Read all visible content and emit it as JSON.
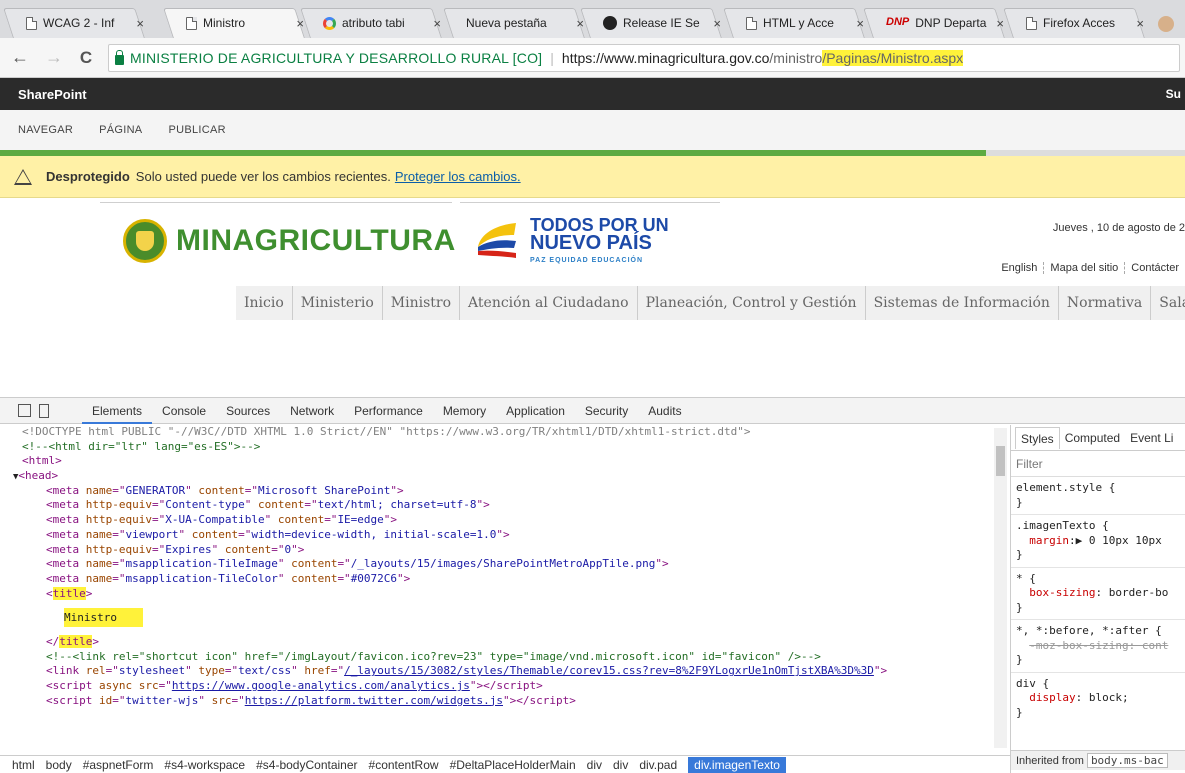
{
  "browser": {
    "tabs": [
      {
        "title": "WCAG 2 - Inf",
        "icon": "page-icon"
      },
      {
        "title": "Ministro",
        "icon": "page-icon",
        "active": true
      },
      {
        "title": "atributo tabi",
        "icon": "google-icon"
      },
      {
        "title": "Nueva pestaña",
        "icon": "none"
      },
      {
        "title": "Release IE Se",
        "icon": "github-icon"
      },
      {
        "title": "HTML y Acce",
        "icon": "page-icon"
      },
      {
        "title": "DNP Departa",
        "icon": "dnp-icon"
      },
      {
        "title": "Firefox Acces",
        "icon": "page-icon"
      }
    ],
    "close_glyph": "×",
    "dnp_logo": "DNP",
    "back": "←",
    "forward": "→",
    "reload": "C",
    "secure_label": "MINISTERIO DE AGRICULTURA Y DESARROLLO RURAL [CO]",
    "url_host": "https://www.minagricultura.gov.co",
    "url_path": "/ministro",
    "url_path_highlighted": "/Paginas/Ministro.aspx"
  },
  "sharepoint": {
    "brand": "SharePoint",
    "right_text": "Su",
    "ribbon": [
      "NAVEGAR",
      "PÁGINA",
      "PUBLICAR"
    ],
    "progress": 0.832,
    "status_bold": "Desprotegido",
    "status_text": "Solo usted puede ver los cambios recientes.",
    "status_link": "Proteger los cambios."
  },
  "site": {
    "logo_text": "MINAGRICULTURA",
    "logo2_l1": "TODOS POR UN",
    "logo2_l2": "NUEVO PAÍS",
    "logo2_l3": "PAZ  EQUIDAD  EDUCACIÓN",
    "date": "Jueves , 10 de agosto de 2",
    "top_links": [
      "English",
      "Mapa del sitio",
      "Contácter"
    ],
    "nav": [
      "Inicio",
      "Ministerio",
      "Ministro",
      "Atención al Ciudadano",
      "Planeación, Control y Gestión",
      "Sistemas de Información",
      "Normativa",
      "Sala de P"
    ]
  },
  "devtools": {
    "tabs": [
      "Elements",
      "Console",
      "Sources",
      "Network",
      "Performance",
      "Memory",
      "Application",
      "Security",
      "Audits"
    ],
    "breadcrumbs": [
      "html",
      "body",
      "#aspnetForm",
      "#s4-workspace",
      "#s4-bodyContainer",
      "#contentRow",
      "#DeltaPlaceHolderMain",
      "div",
      "div",
      "div.pad",
      "div.imagenTexto"
    ],
    "styles_tabs": [
      "Styles",
      "Computed",
      "Event Li"
    ],
    "filter_placeholder": "Filter",
    "inherited_label": "Inherited from",
    "inherited_selector": "body.ms-bac",
    "code": {
      "l1": "<!DOCTYPE html PUBLIC \"-//W3C//DTD XHTML 1.0 Strict//EN\" \"https://www.w3.org/TR/xhtml1/DTD/xhtml1-strict.dtd\">",
      "l2": "<!--<html dir=\"ltr\" lang=\"es-ES\">-->",
      "l3": "<html>",
      "l4": "<head>",
      "m1_name": "GENERATOR",
      "m1_content": "Microsoft SharePoint",
      "m2_equiv": "Content-type",
      "m2_content": "text/html; charset=utf-8",
      "m3_equiv": "X-UA-Compatible",
      "m3_content": "IE=edge",
      "m4_name": "viewport",
      "m4_content": "width=device-width, initial-scale=1.0",
      "m5_equiv": "Expires",
      "m5_content": "0",
      "m6_name": "msapplication-TileImage",
      "m6_content": "/_layouts/15/images/SharePointMetroAppTile.png",
      "m7_name": "msapplication-TileColor",
      "m7_content": "#0072C6",
      "title_tag": "title",
      "title_text": "Ministro",
      "c2": "<!--<link rel=\"shortcut icon\" href=\"/imgLayout/favicon.ico?rev=23\" type=\"image/vnd.microsoft.icon\" id=\"favicon\" />-->",
      "link_href": "/_layouts/15/3082/styles/Themable/corev15.css?rev=8%2F9YLogxrUe1nOmTjstXBA%3D%3D",
      "s1_src": "https://www.google-analytics.com/analytics.js",
      "s2_src": "https://platform.twitter.com/widgets.js"
    },
    "rules": {
      "r1": "element.style {",
      "r2sel": ".imagenTexto {",
      "r2prop": "margin",
      "r2val": "▶ 0 10px 10px",
      "r3sel": "* {",
      "r3prop": "box-sizing",
      "r3val": "border-bo",
      "r4sel": "*, *:before, *:after {",
      "r4prop": "-moz-box-sizing: cont",
      "r5sel": "div {",
      "r5prop": "display",
      "r5val": "block;"
    }
  }
}
